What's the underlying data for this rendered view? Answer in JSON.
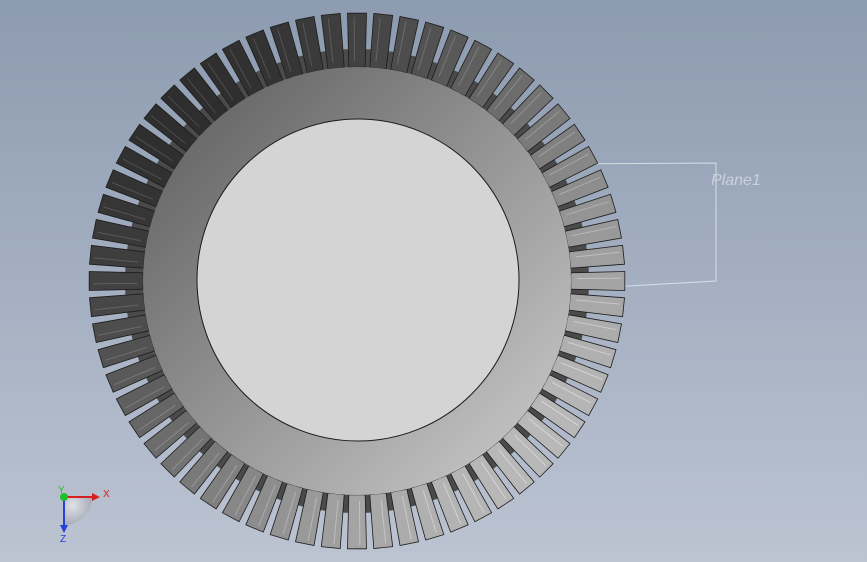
{
  "viewport": {
    "background_top": "#8d9bb0",
    "background_bottom": "#bcc4d2"
  },
  "model": {
    "name": "bevel-gear",
    "tooth_count": 64,
    "tooth_light": "#b8b8b8",
    "tooth_dark": "#2e2e2e",
    "bore_face_color": "#d4d4d4"
  },
  "plane": {
    "label": "Plane1",
    "color": "#d8dee6"
  },
  "triad": {
    "x_label": "X",
    "y_label": "Y",
    "z_label": "Z",
    "x_color": "#d62020",
    "y_color": "#1fbf2a",
    "z_color": "#2840d8"
  }
}
